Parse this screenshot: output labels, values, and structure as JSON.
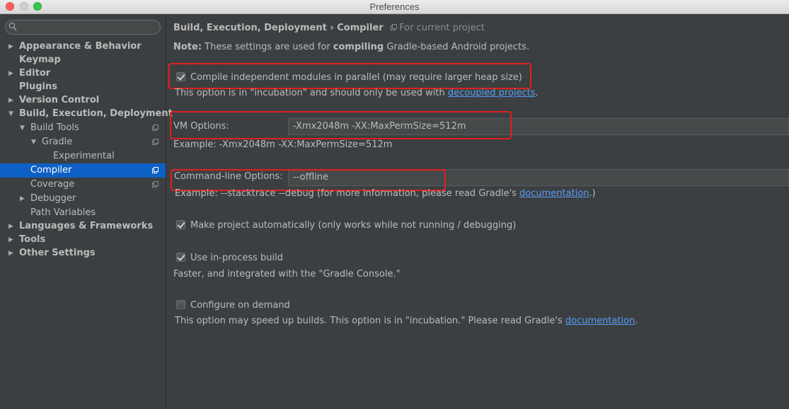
{
  "window": {
    "title": "Preferences"
  },
  "search": {
    "placeholder": ""
  },
  "tree": [
    {
      "label": "Appearance & Behavior",
      "arrow": "▶",
      "bold": true
    },
    {
      "label": "Keymap",
      "arrow": "",
      "bold": true
    },
    {
      "label": "Editor",
      "arrow": "▶",
      "bold": true
    },
    {
      "label": "Plugins",
      "arrow": "",
      "bold": true
    },
    {
      "label": "Version Control",
      "arrow": "▶",
      "bold": true
    },
    {
      "label": "Build, Execution, Deployment",
      "arrow": "▼",
      "bold": true
    },
    {
      "label": "Build Tools",
      "arrow": "▼",
      "bold": false
    },
    {
      "label": "Gradle",
      "arrow": "▼",
      "bold": false
    },
    {
      "label": "Experimental",
      "arrow": "",
      "bold": false
    },
    {
      "label": "Compiler",
      "arrow": "",
      "bold": false,
      "selected": true
    },
    {
      "label": "Coverage",
      "arrow": "",
      "bold": false
    },
    {
      "label": "Debugger",
      "arrow": "▶",
      "bold": false
    },
    {
      "label": "Path Variables",
      "arrow": "",
      "bold": false
    },
    {
      "label": "Languages & Frameworks",
      "arrow": "▶",
      "bold": true
    },
    {
      "label": "Tools",
      "arrow": "▶",
      "bold": true
    },
    {
      "label": "Other Settings",
      "arrow": "▶",
      "bold": true
    }
  ],
  "content": {
    "breadcrumb": "Build, Execution, Deployment › Compiler",
    "scope": "For current project",
    "note_label": "Note:",
    "note_text_1": " These settings are used for ",
    "note_bold": "compiling",
    "note_text_2": " Gradle-based Android projects.",
    "parallel": {
      "checked": true,
      "label": "Compile independent modules in parallel (may require larger heap size)",
      "hint_text": "This option is in \"incubation\" and should only be used with ",
      "hint_link": "decoupled projects",
      "hint_end": "."
    },
    "vm_options": {
      "label": "VM Options:",
      "value": "-Xmx2048m -XX:MaxPermSize=512m",
      "example": "Example: -Xmx2048m -XX:MaxPermSize=512m"
    },
    "cmd_options": {
      "label": "Command-line Options:",
      "value": "--offline",
      "example_text": "Example: --stacktrace --debug (for more information, please read Gradle's ",
      "example_link": "documentation",
      "example_end": ".)"
    },
    "make_auto": {
      "checked": true,
      "label": "Make project automatically (only works while not running / debugging)"
    },
    "in_process": {
      "checked": true,
      "label": "Use in-process build",
      "hint": "Faster, and integrated with the \"Gradle Console.\""
    },
    "on_demand": {
      "checked": false,
      "label": "Configure on demand",
      "hint_text": "This option may speed up builds. This option is in \"incubation.\" Please read Gradle's ",
      "hint_link": "documentation",
      "hint_end": "."
    }
  },
  "colors": {
    "accent": "#0d60c5",
    "link": "#589df6",
    "highlight": "#e02020"
  }
}
